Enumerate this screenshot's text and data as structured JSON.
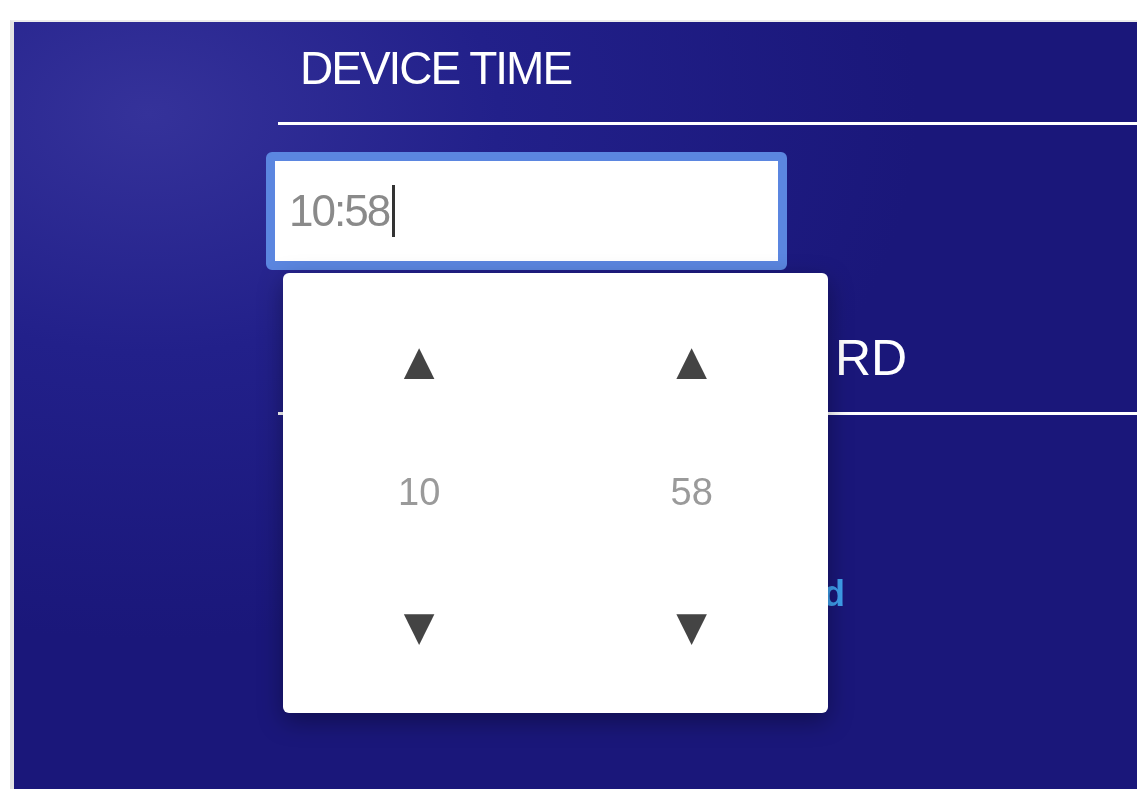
{
  "device_time": {
    "label": "DEVICE TIME",
    "value": "10:58"
  },
  "time_picker": {
    "columns": [
      {
        "up": "▲",
        "value": "10",
        "down": "▼"
      },
      {
        "up": "▲",
        "value": "58",
        "down": "▼"
      }
    ]
  },
  "next_section": {
    "heading_fragment": "RD",
    "link_fragment": "d"
  }
}
